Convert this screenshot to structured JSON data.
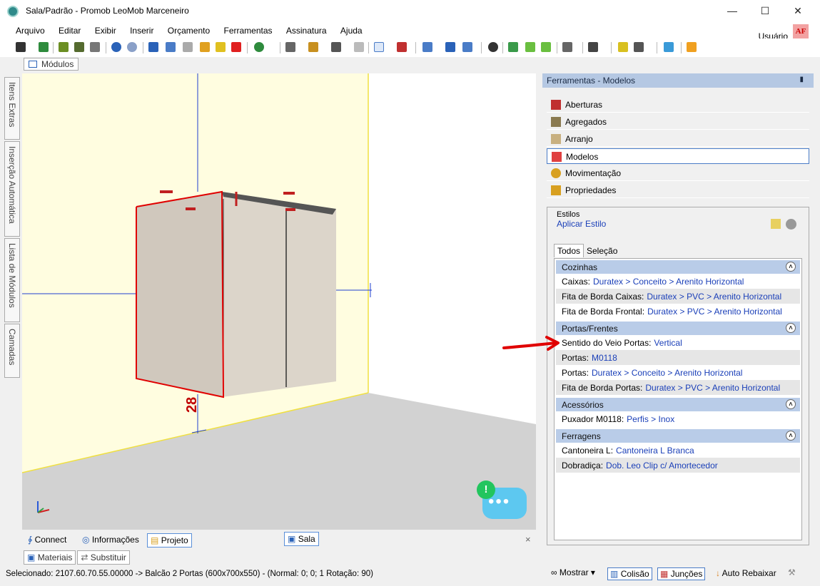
{
  "window": {
    "title": "Sala/Padrão - Promob LeoMob Marceneiro",
    "minimize": "—",
    "maximize": "☐",
    "close": "✕"
  },
  "menu": [
    "Arquivo",
    "Editar",
    "Exibir",
    "Inserir",
    "Orçamento",
    "Ferramentas",
    "Assinatura",
    "Ajuda"
  ],
  "user": {
    "label": "Usuário",
    "initials": "AF"
  },
  "modules_tab": "Módulos",
  "left_tabs": [
    "Itens Extras",
    "Inserção Automática",
    "Lista de Módulos",
    "Camadas"
  ],
  "viewport": {
    "dimension_label": "28"
  },
  "bottom_tabs": {
    "connect": "Connect",
    "info": "Informações",
    "project": "Projeto",
    "scene": "Sala",
    "close": "×"
  },
  "lower_tabs": [
    "Materiais",
    "Substituir"
  ],
  "status": {
    "text": "Selecionado: 2107.60.70.55.00000 -> Balcão 2 Portas (600x700x550) - (Normal: 0; 0; 1 Rotação: 90)",
    "show": "Mostrar",
    "collision": "Colisão",
    "joints": "Junções",
    "auto": "Auto Rebaixar"
  },
  "panel": {
    "title": "Ferramentas - Modelos",
    "pin": "📌",
    "tools": [
      "Aberturas",
      "Agregados",
      "Arranjo",
      "Modelos",
      "Movimentação",
      "Propriedades"
    ],
    "styles_label": "Estilos",
    "apply_style": "Aplicar Estilo",
    "tabs": [
      "Todos",
      "Seleção"
    ],
    "groups": [
      {
        "title": "Cozinhas",
        "rows": [
          {
            "label": "Caixas:",
            "value": "Duratex > Conceito > Arenito Horizontal"
          },
          {
            "label": "Fita de Borda Caixas:",
            "value": "Duratex > PVC > Arenito Horizontal"
          },
          {
            "label": "Fita de Borda Frontal:",
            "value": "Duratex > PVC > Arenito Horizontal"
          }
        ]
      },
      {
        "title": "Portas/Frentes",
        "rows": [
          {
            "label": "Sentido do Veio Portas:",
            "value": "Vertical"
          },
          {
            "label": "Portas:",
            "value": "M0118"
          },
          {
            "label": "Portas:",
            "value": "Duratex > Conceito > Arenito Horizontal"
          },
          {
            "label": "Fita de Borda Portas:",
            "value": "Duratex > PVC > Arenito Horizontal"
          }
        ]
      },
      {
        "title": "Acessórios",
        "rows": [
          {
            "label": "Puxador M0118:",
            "value": "Perfis > Inox"
          }
        ]
      },
      {
        "title": "Ferragens",
        "rows": [
          {
            "label": "Cantoneira L:",
            "value": "Cantoneira L Branca"
          },
          {
            "label": "Dobradiça:",
            "value": "Dob. Leo Clip c/ Amortecedor"
          }
        ]
      }
    ]
  },
  "chat": {
    "badge": "!",
    "dots": "•••"
  },
  "colors": {
    "accent": "#4a7cc7",
    "group_header": "#b9cce8",
    "link": "#1a3fb8",
    "arrow": "#e00000"
  }
}
